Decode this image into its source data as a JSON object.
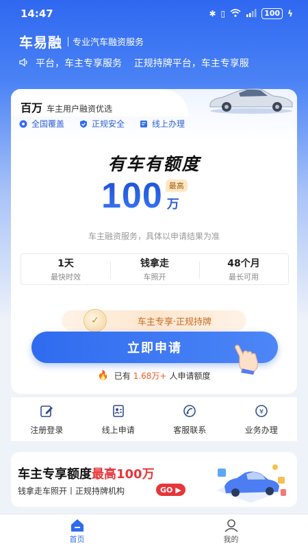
{
  "status_bar": {
    "time": "14:47",
    "battery": "100"
  },
  "brand": {
    "name": "车易融",
    "tagline": "专业汽车融资服务"
  },
  "marquee": {
    "text": "平台，车主专享服务    正规持牌平台，车主专享服"
  },
  "card": {
    "title": "百万",
    "subtitle": "车主用户融资优选",
    "features": [
      "全国覆盖",
      "正规安全",
      "线上办理"
    ],
    "headline": "有车有额度",
    "amount": "100",
    "amount_badge": "最高",
    "amount_unit": "万",
    "disclaimer": "车主融资服务，具体以申请结果为准",
    "stats": [
      {
        "value": "1天",
        "label": "最快时效"
      },
      {
        "value": "钱拿走",
        "label": "车照开"
      },
      {
        "value": "48个月",
        "label": "最长可用"
      }
    ],
    "promo": "车主专享·正规持牌",
    "apply_button": "立即申请",
    "applicants_prefix": "已有",
    "applicants_count": "1.68万+",
    "applicants_suffix": "人申请额度"
  },
  "quick_actions": [
    {
      "label": "注册登录",
      "icon": "edit-icon"
    },
    {
      "label": "线上申请",
      "icon": "form-icon"
    },
    {
      "label": "客服联系",
      "icon": "headset-icon"
    },
    {
      "label": "业务办理",
      "icon": "yuan-icon"
    }
  ],
  "banner": {
    "title_part1": "车主专享额度",
    "title_part2": "最高100万",
    "subtitle": "钱拿走车照开丨正规持牌机构",
    "go_label": "GO"
  },
  "tabbar": [
    {
      "label": "首页",
      "active": true
    },
    {
      "label": "我的",
      "active": false
    }
  ],
  "colors": {
    "primary": "#2f6bef",
    "accent_red": "#e7353a",
    "accent_orange": "#f05a24"
  }
}
